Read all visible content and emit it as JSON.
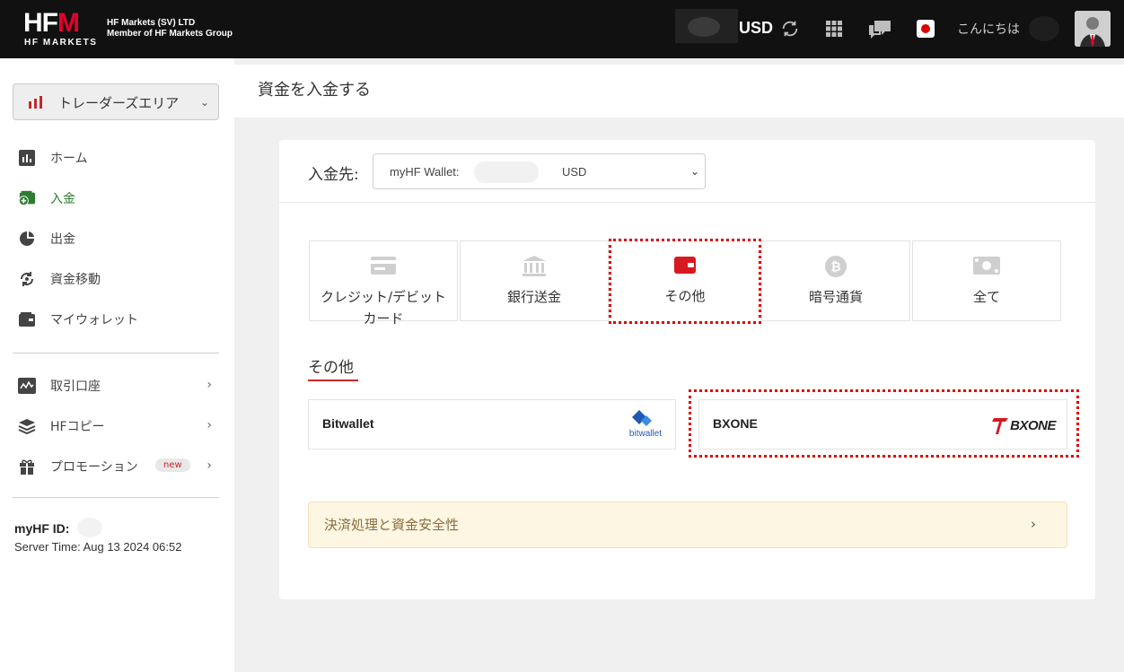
{
  "header": {
    "logo_text": "HFM",
    "logo_sub": "HF MARKETS",
    "company_line1": "HF Markets (SV) LTD",
    "company_line2": "Member of HF Markets Group",
    "currency": "USD",
    "greeting": "こんにちは",
    "icons": [
      "refresh-icon",
      "apps-grid-icon",
      "chat-icon",
      "japan-flag-icon",
      "user-avatar"
    ]
  },
  "sidebar": {
    "area_label": "トレーダーズエリア",
    "items": [
      {
        "label": "ホーム",
        "icon": "chart-icon"
      },
      {
        "label": "入金",
        "icon": "deposit-wallet-icon",
        "active": true
      },
      {
        "label": "出金",
        "icon": "withdraw-icon"
      },
      {
        "label": "資金移動",
        "icon": "transfer-icon"
      },
      {
        "label": "マイウォレット",
        "icon": "wallet-icon"
      }
    ],
    "items2": [
      {
        "label": "取引口座",
        "icon": "account-chart-icon"
      },
      {
        "label": "HFコピー",
        "icon": "layers-icon"
      },
      {
        "label": "プロモーション",
        "icon": "gift-icon",
        "badge": "new"
      }
    ],
    "myhf_id_label": "myHF ID:",
    "server_time": "Server Time: Aug 13 2024 06:52"
  },
  "main": {
    "page_title": "資金を入金する",
    "destination_label": "入金先:",
    "wallet_label": "myHF Wallet:",
    "wallet_currency": "USD",
    "methods": [
      {
        "label": "クレジット/デビットカード",
        "icon": "credit-card-icon"
      },
      {
        "label": "銀行送金",
        "icon": "bank-icon"
      },
      {
        "label": "その他",
        "icon": "wallet-icon",
        "selected": true
      },
      {
        "label": "暗号通貨",
        "icon": "bitcoin-icon"
      },
      {
        "label": "全て",
        "icon": "cash-icon"
      }
    ],
    "section_title": "その他",
    "providers": [
      {
        "name": "Bitwallet",
        "logo": "bitwallet"
      },
      {
        "name": "BXONE",
        "logo": "BXONE"
      }
    ],
    "notice_text": "決済処理と資金安全性"
  },
  "colors": {
    "accent_red": "#e4002b",
    "active_green": "#2e7d32",
    "notice_bg": "#fdf6e3"
  }
}
